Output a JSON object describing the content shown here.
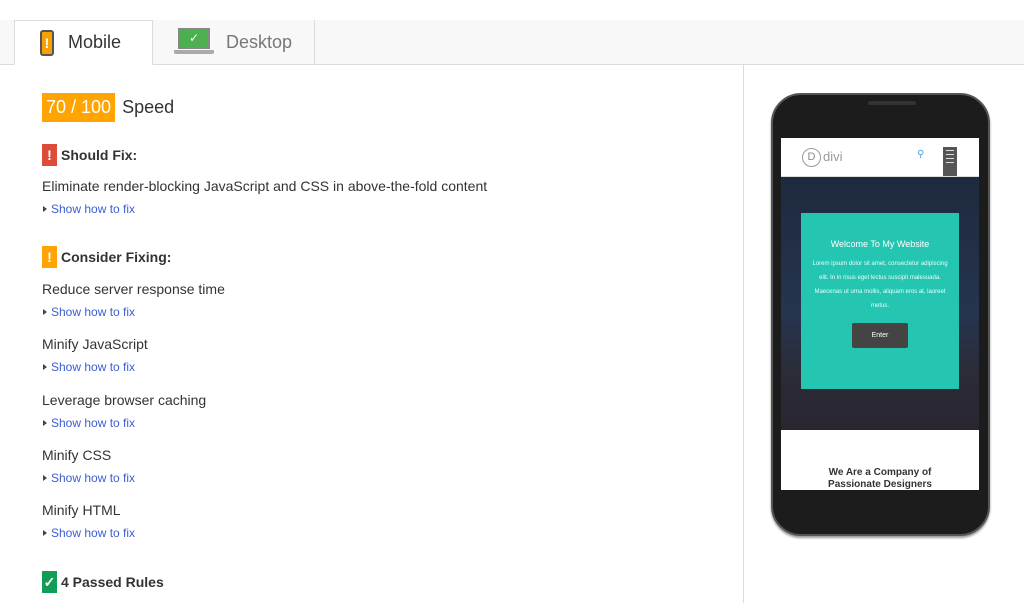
{
  "tabs": [
    {
      "label": "Mobile",
      "icon": "mobile-phone-icon",
      "active": true
    },
    {
      "label": "Desktop",
      "icon": "desktop-laptop-icon",
      "active": false
    }
  ],
  "score": {
    "value": "70 / 100",
    "label": "Speed",
    "color": "#ffa400"
  },
  "should_fix": {
    "badge": "!",
    "heading": "Should Fix:",
    "rules": [
      {
        "title": "Eliminate render-blocking JavaScript and CSS in above-the-fold content",
        "link": "Show how to fix"
      }
    ]
  },
  "consider_fixing": {
    "badge": "!",
    "heading": "Consider Fixing:",
    "rules": [
      {
        "title": "Reduce server response time",
        "link": "Show how to fix"
      },
      {
        "title": "Minify JavaScript",
        "link": "Show how to fix"
      },
      {
        "title": "Leverage browser caching",
        "link": "Show how to fix"
      },
      {
        "title": "Minify CSS",
        "link": "Show how to fix"
      },
      {
        "title": "Minify HTML",
        "link": "Show how to fix"
      }
    ]
  },
  "passed": {
    "badge": "✓",
    "heading": "4 Passed Rules"
  },
  "preview": {
    "logo_letter": "D",
    "logo_text": "divi",
    "card_title": "Welcome To My Website",
    "card_body": "Lorem ipsum dolor sit amet, consectetur adipiscing elit. In in risus eget lectus suscipit malesuada. Maecenas ut urna mollis, aliquam eros at, laoreet metus.",
    "enter_label": "Enter",
    "company_line1": "We Are a Company of",
    "company_line2": "Passionate Designers"
  }
}
